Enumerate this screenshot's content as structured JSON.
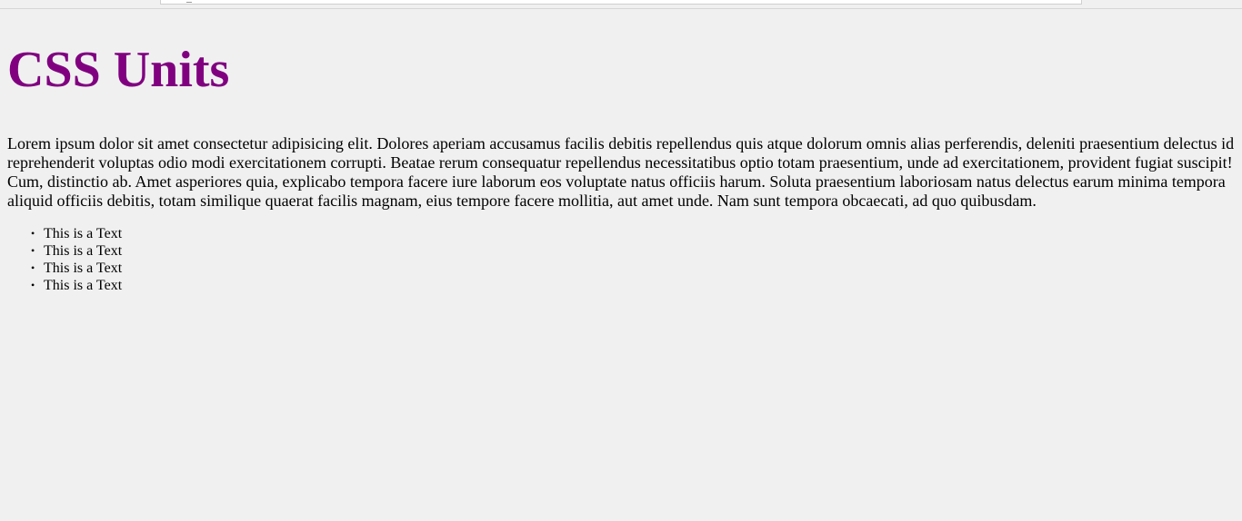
{
  "page": {
    "title": "CSS Units",
    "paragraph": "Lorem ipsum dolor sit amet consectetur adipisicing elit. Dolores aperiam accusamus facilis debitis repellendus quis atque dolorum omnis alias perferendis, deleniti praesentium delectus id reprehenderit voluptas odio modi exercitationem corrupti. Beatae rerum consequatur repellendus necessitatibus optio totam praesentium, unde ad exercitationem, provident fugiat suscipit! Cum, distinctio ab. Amet asperiores quia, explicabo tempora facere iure laborum eos voluptate natus officiis harum. Soluta praesentium laboriosam natus delectus earum minima tempora aliquid officiis debitis, totam similique quaerat facilis magnam, eius tempore facere mollitia, aut amet unde. Nam sunt tempora obcaecati, ad quo quibusdam.",
    "list": [
      {
        "label": "This is a Text"
      },
      {
        "label": "This is a Text"
      },
      {
        "label": "This is a Text"
      },
      {
        "label": "This is a Text"
      }
    ]
  },
  "colors": {
    "title": "#800080",
    "background": "#f0f0f0",
    "text": "#000000"
  }
}
